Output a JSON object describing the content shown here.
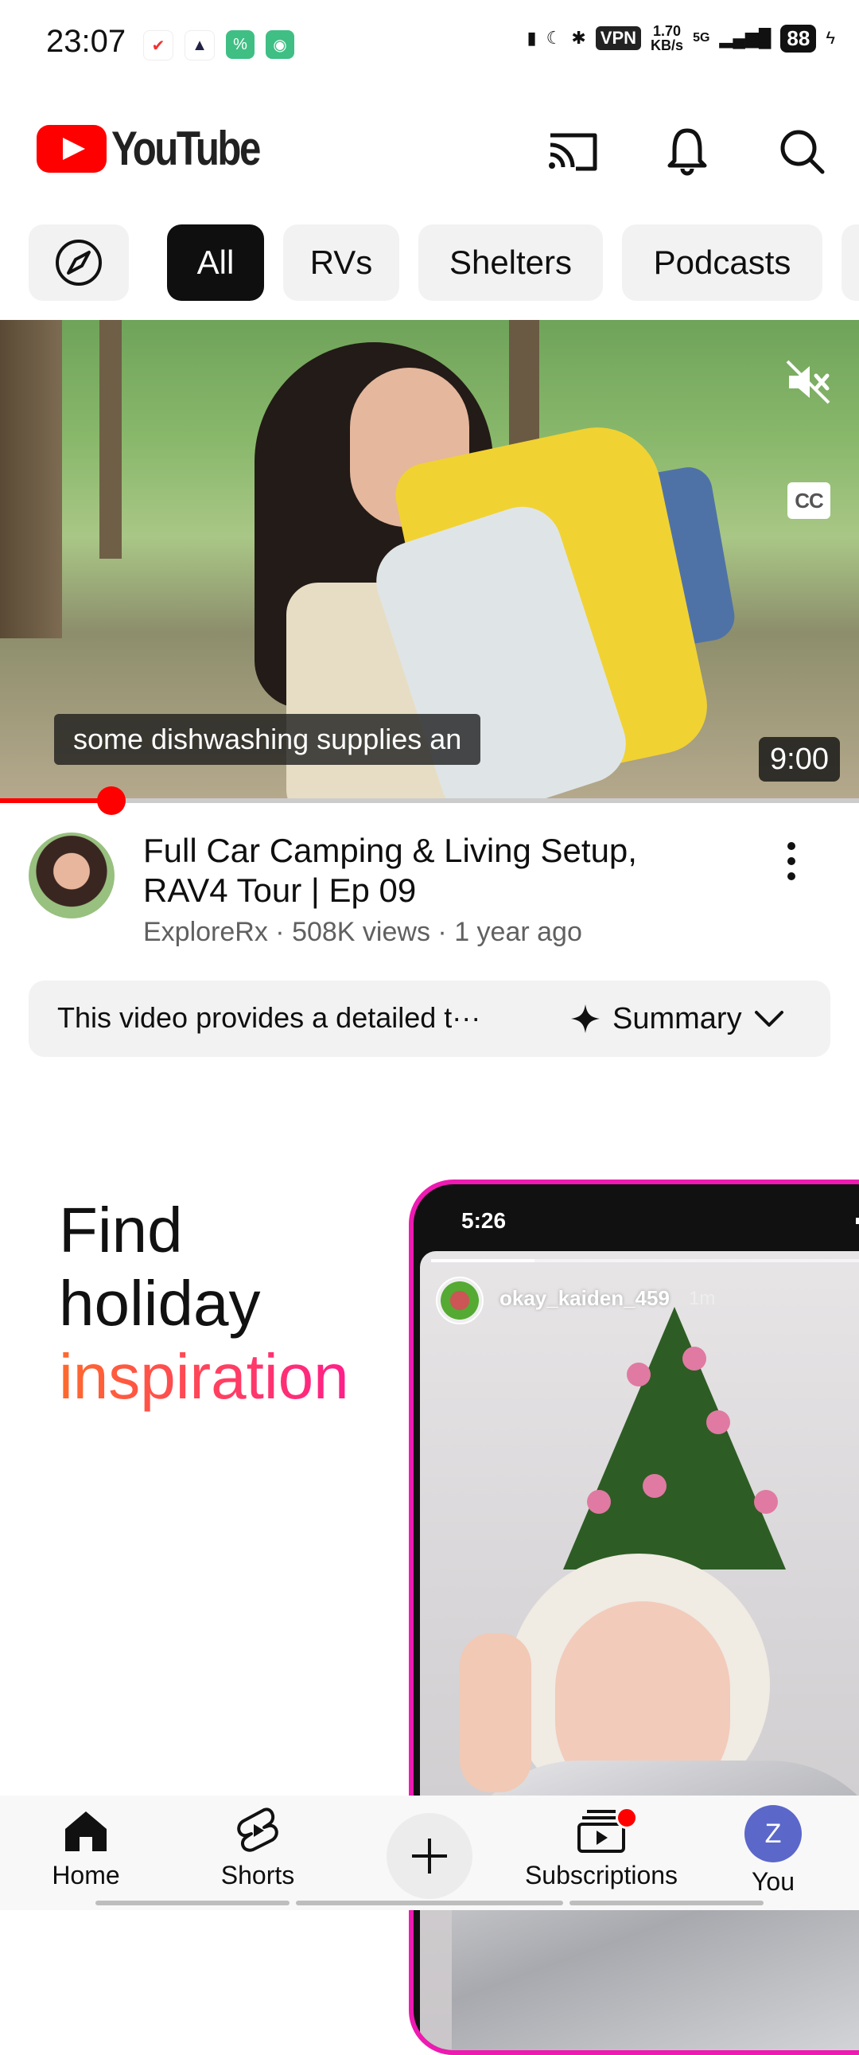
{
  "status": {
    "time": "23:07",
    "vpn": "VPN",
    "speed_value": "1.70",
    "speed_unit": "KB/s",
    "network": "5G",
    "battery": "88"
  },
  "header": {
    "logo_text": "YouTube",
    "brand_color": "#ff0000"
  },
  "chips": [
    "All",
    "RVs",
    "Shelters",
    "Podcasts"
  ],
  "video": {
    "caption": "some dishwashing supplies an",
    "duration": "9:00",
    "progress_fraction": 0.13,
    "title": "Full Car Camping & Living Setup, RAV4 Tour | Ep 09",
    "channel": "ExploreRx",
    "views": "508K views",
    "age": "1 year ago",
    "summary_preview": "This video provides a detailed t···",
    "summary_label": "Summary",
    "cc_label": "CC"
  },
  "promo": {
    "line1": "Find",
    "line2": "holiday",
    "line3": "inspiration",
    "phone_time": "5:26",
    "story_user": "okay_kaiden_459",
    "story_age": "1m"
  },
  "nav": {
    "home": "Home",
    "shorts": "Shorts",
    "subscriptions": "Subscriptions",
    "you": "You",
    "you_initial": "Z"
  }
}
